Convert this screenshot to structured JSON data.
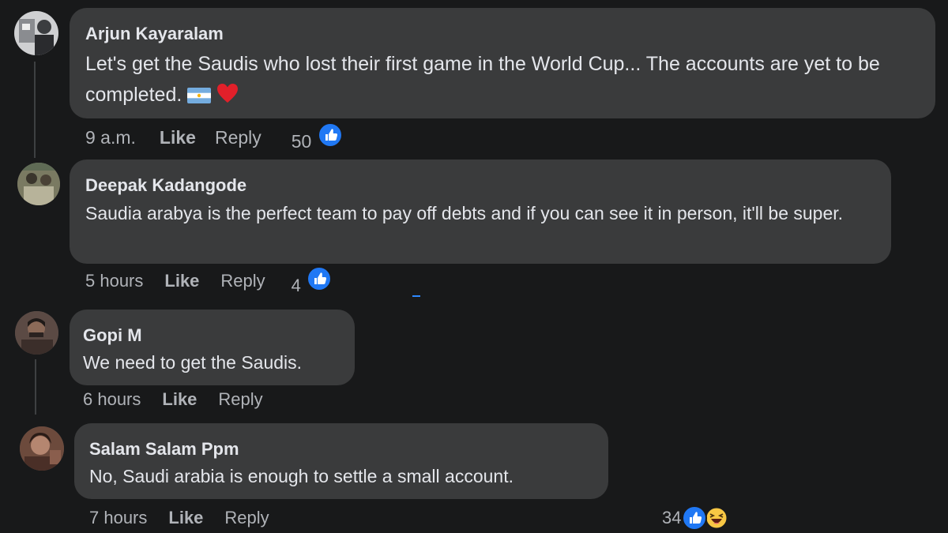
{
  "comments": [
    {
      "author": "Arjun Kayaralam",
      "text": "Let's get the Saudis who lost their first game in the World Cup... The accounts are yet to be completed.",
      "emoji": [
        "flag-argentina-icon",
        "red-heart-icon"
      ],
      "time": "9 a.m.",
      "like_label": "Like",
      "reply_label": "Reply",
      "reaction_count": "50",
      "reactions": [
        "like"
      ]
    },
    {
      "author": "Deepak Kadangode",
      "text": "Saudia arabya is the perfect team to pay off debts and if you can see it in person, it'll be super.",
      "time": "5 hours",
      "like_label": "Like",
      "reply_label": "Reply",
      "reaction_count": "4",
      "reactions": [
        "like"
      ]
    },
    {
      "author": "Gopi M",
      "text": "We need to get the Saudis.",
      "time": "6 hours",
      "like_label": "Like",
      "reply_label": "Reply"
    },
    {
      "author": "Salam Salam Ppm",
      "text": "No, Saudi arabia is enough to settle a small account.",
      "time": "7 hours",
      "like_label": "Like",
      "reply_label": "Reply",
      "reaction_count": "34",
      "reactions": [
        "like",
        "haha"
      ]
    }
  ],
  "colors": {
    "background": "#18191a",
    "bubble": "#3a3b3c",
    "text": "#e4e6eb",
    "meta": "#b0b3b8",
    "like_blue": "#2078f4"
  }
}
